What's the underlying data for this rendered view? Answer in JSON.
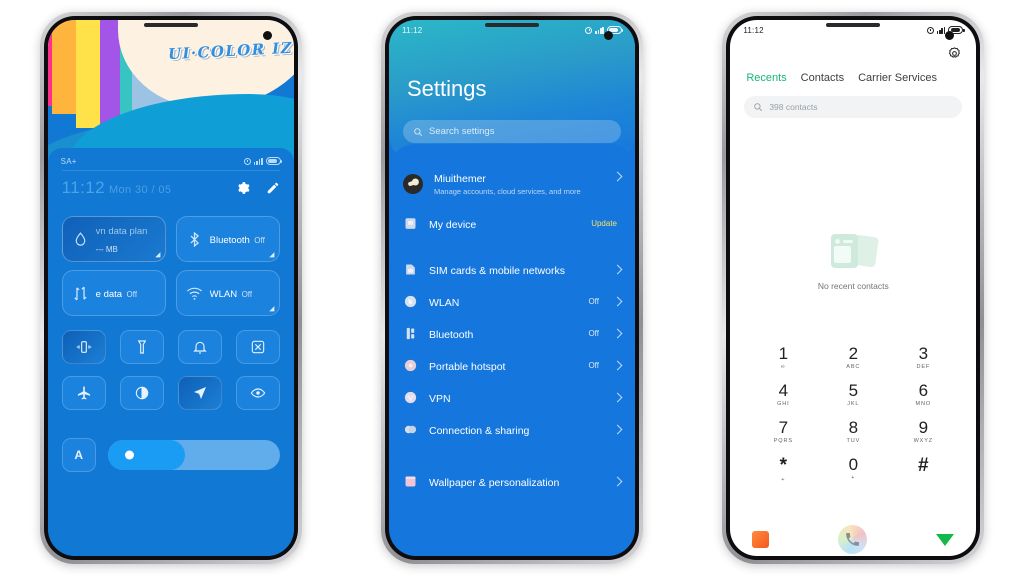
{
  "phone1": {
    "name": "control-center",
    "wallpaper_title": "UI·COLOR IZ",
    "statusbar": {
      "network": "SA+",
      "alarm_icon": "alarm-icon",
      "signal_icon": "signal-icon",
      "battery_icon": "battery-icon"
    },
    "clock": {
      "time": "11:12",
      "date": "Mon 30 / 05"
    },
    "actions": [
      {
        "name": "settings-gear-icon",
        "label": "gear-icon"
      },
      {
        "name": "edit-pencil-icon",
        "label": "pencil-icon"
      }
    ],
    "big_tiles": [
      {
        "icon": "data-drop-icon",
        "title": "vn data plan",
        "sub": "--- MB",
        "active": true,
        "corner": "expand-icon"
      },
      {
        "icon": "bluetooth-icon",
        "title": "Bluetooth",
        "sub": "Off",
        "active": false,
        "corner": "expand-icon"
      },
      {
        "icon": "mobile-data-icon",
        "title": "e data",
        "sub": "Off",
        "active": false,
        "corner": ""
      },
      {
        "icon": "wlan-icon",
        "title": "WLAN",
        "sub": "Off",
        "active": false,
        "corner": "expand-icon"
      }
    ],
    "small_tiles": [
      {
        "icon": "vibrate-icon",
        "on": true
      },
      {
        "icon": "flashlight-icon",
        "on": false
      },
      {
        "icon": "bell-icon",
        "on": false
      },
      {
        "icon": "screenshot-icon",
        "on": false
      },
      {
        "icon": "airplane-icon",
        "on": false
      },
      {
        "icon": "dark-mode-icon",
        "on": false
      },
      {
        "icon": "location-icon",
        "on": true
      },
      {
        "icon": "eye-care-icon",
        "on": false
      }
    ],
    "brightness": {
      "auto_label": "A",
      "level_percent": 45
    }
  },
  "phone2": {
    "name": "settings",
    "statusbar": {
      "time": "11:12"
    },
    "title": "Settings",
    "search_placeholder": "Search settings",
    "search_icon": "search-icon",
    "rows": [
      {
        "type": "account",
        "icon": "account-avatar",
        "label": "Miuithemer",
        "sub": "Manage accounts, cloud services, and more",
        "right": "",
        "chevron": true
      },
      {
        "type": "item",
        "icon": "device-icon",
        "label": "My device",
        "sub": "",
        "right": "Update",
        "right_style": "update",
        "chevron": false
      },
      {
        "type": "gap"
      },
      {
        "type": "item",
        "icon": "sim-icon",
        "label": "SIM cards & mobile networks",
        "sub": "",
        "right": "",
        "chevron": true
      },
      {
        "type": "item",
        "icon": "wlan-icon",
        "label": "WLAN",
        "sub": "",
        "right": "Off",
        "chevron": true
      },
      {
        "type": "item",
        "icon": "bluetooth-icon",
        "label": "Bluetooth",
        "sub": "",
        "right": "Off",
        "chevron": true
      },
      {
        "type": "item",
        "icon": "hotspot-icon",
        "label": "Portable hotspot",
        "sub": "",
        "right": "Off",
        "chevron": true
      },
      {
        "type": "item",
        "icon": "vpn-icon",
        "label": "VPN",
        "sub": "",
        "right": "",
        "chevron": true
      },
      {
        "type": "item",
        "icon": "connection-sharing-icon",
        "label": "Connection & sharing",
        "sub": "",
        "right": "",
        "chevron": true
      },
      {
        "type": "gap-big"
      },
      {
        "type": "item",
        "icon": "wallpaper-icon",
        "label": "Wallpaper & personalization",
        "sub": "",
        "right": "",
        "chevron": true
      }
    ]
  },
  "phone3": {
    "name": "dialer",
    "statusbar": {
      "time": "11:12"
    },
    "gear_icon": "settings-gear-icon",
    "tabs": [
      {
        "label": "Recents",
        "active": true
      },
      {
        "label": "Contacts",
        "active": false
      },
      {
        "label": "Carrier Services",
        "active": false
      }
    ],
    "search_placeholder": "398 contacts",
    "search_icon": "search-icon",
    "empty_state": {
      "icon": "contact-cards-icon",
      "text": "No recent contacts"
    },
    "keypad": [
      {
        "num": "1",
        "sub": "∞"
      },
      {
        "num": "2",
        "sub": "ABC"
      },
      {
        "num": "3",
        "sub": "DEF"
      },
      {
        "num": "4",
        "sub": "GHI"
      },
      {
        "num": "5",
        "sub": "JKL"
      },
      {
        "num": "6",
        "sub": "MNO"
      },
      {
        "num": "7",
        "sub": "PQRS"
      },
      {
        "num": "8",
        "sub": "TUV"
      },
      {
        "num": "9",
        "sub": "WXYZ"
      },
      {
        "num": "*",
        "sub": "+"
      },
      {
        "num": "0",
        "sub": "+"
      },
      {
        "num": "#",
        "sub": ""
      }
    ],
    "actions": [
      {
        "name": "keypad-extra-button",
        "icon": "orange-square-icon"
      },
      {
        "name": "call-button",
        "icon": "phone-handset-icon"
      },
      {
        "name": "hide-keypad-button",
        "icon": "down-triangle-icon"
      }
    ]
  },
  "colors": {
    "accent_blue": "#1178d4",
    "settings_teal": "#2bb8c8",
    "recents_green": "#18b67a",
    "update_yellow": "#f2e06a",
    "call_green": "#12b84a",
    "orange": "#f4581f"
  }
}
